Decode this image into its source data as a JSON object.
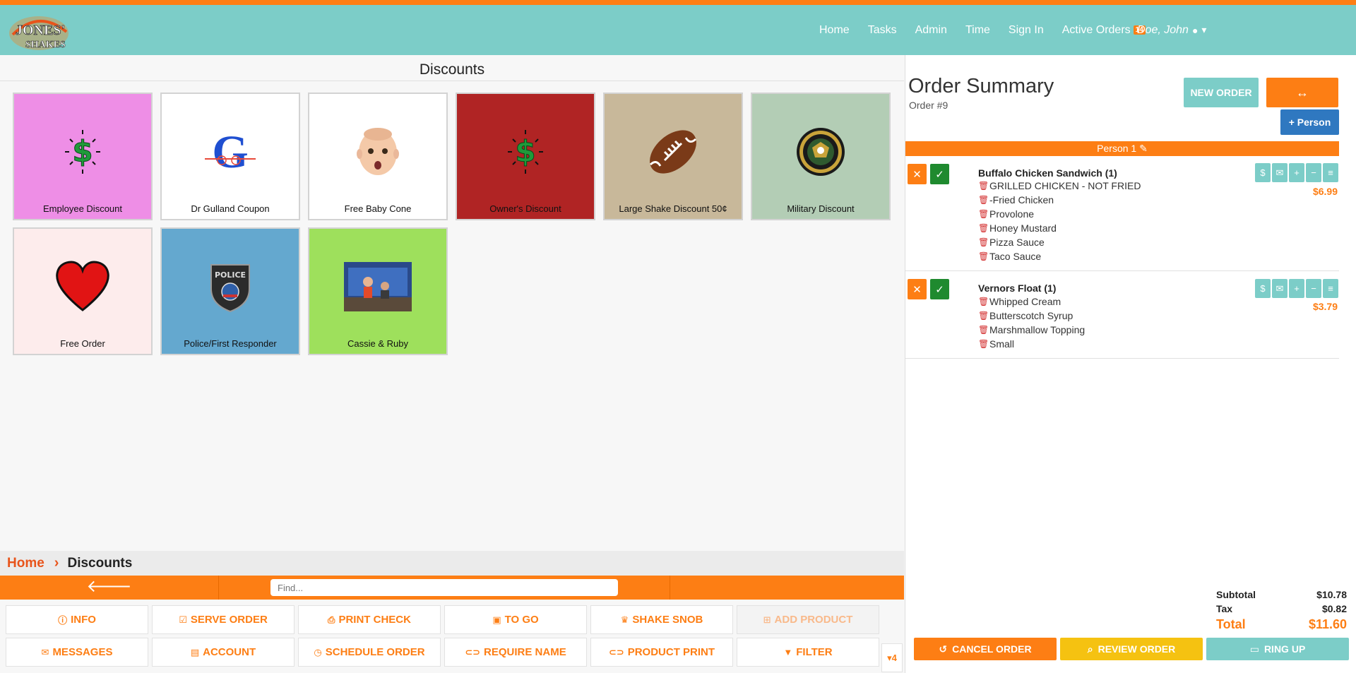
{
  "app": {
    "logo_text": "JONES' SHAKES",
    "nav": [
      {
        "label": "Home"
      },
      {
        "label": "Tasks"
      },
      {
        "label": "Admin"
      },
      {
        "label": "Time"
      },
      {
        "label": "Sign In"
      },
      {
        "label": "Active Orders",
        "badge": "14"
      }
    ],
    "user": "Doe, John"
  },
  "colors": {
    "accent": "#fd7e14",
    "teal": "#7ccdc8",
    "blue": "#2f78c0",
    "green": "#1f8a2f",
    "yellow": "#f5c211"
  },
  "discounts": {
    "title": "Discounts",
    "tiles": [
      {
        "label": "Employee Discount",
        "bg": "#ee8ee6",
        "icon": "dollar-icon"
      },
      {
        "label": "Dr Gulland Coupon",
        "bg": "#ffffff",
        "icon": "gulland-logo"
      },
      {
        "label": "Free Baby Cone",
        "bg": "#ffffff",
        "icon": "baby-face"
      },
      {
        "label": "Owner's Discount",
        "bg": "#b02424",
        "icon": "dollar-icon"
      },
      {
        "label": "Large Shake Discount 50¢",
        "bg": "#c8b89a",
        "icon": "football-icon"
      },
      {
        "label": "Military Discount",
        "bg": "#b3cdb5",
        "icon": "army-seal"
      },
      {
        "label": "Free Order",
        "bg": "#fdecec",
        "icon": "heart-icon"
      },
      {
        "label": "Police/First Responder",
        "bg": "#64a8cf",
        "icon": "police-badge"
      },
      {
        "label": "Cassie & Ruby",
        "bg": "#9ee05c",
        "icon": "photo"
      }
    ]
  },
  "breadcrumb": {
    "home": "Home",
    "current": "Discounts"
  },
  "search": {
    "placeholder": "Find..."
  },
  "actions": {
    "row1": [
      {
        "label": "INFO",
        "icon": "info-icon"
      },
      {
        "label": "SERVE ORDER",
        "icon": "check-square-icon"
      },
      {
        "label": "PRINT CHECK",
        "icon": "print-icon"
      },
      {
        "label": "TO GO",
        "icon": "bag-icon"
      },
      {
        "label": "SHAKE SNOB",
        "icon": "crown-icon"
      },
      {
        "label": "ADD PRODUCT",
        "icon": "plus-square-icon"
      }
    ],
    "row2": [
      {
        "label": "MESSAGES",
        "icon": "envelope-icon"
      },
      {
        "label": "ACCOUNT",
        "icon": "account-icon"
      },
      {
        "label": "SCHEDULE ORDER",
        "icon": "clock-icon"
      },
      {
        "label": "REQUIRE NAME",
        "icon": "toggle-icon"
      },
      {
        "label": "PRODUCT PRINT",
        "icon": "toggle-icon"
      },
      {
        "label": "FILTER",
        "icon": "filter-icon"
      }
    ],
    "more": "4"
  },
  "order": {
    "title": "Order Summary",
    "number": "Order #9",
    "new_order": "NEW ORDER",
    "swap": "↔",
    "add_person": "+ Person",
    "person": "Person 1",
    "items": [
      {
        "name": "Buffalo Chicken Sandwich (1)",
        "price": "$6.99",
        "mods": [
          "GRILLED CHICKEN - NOT FRIED",
          "-Fried Chicken",
          "Provolone",
          "Honey Mustard",
          "Pizza Sauce",
          "Taco Sauce"
        ]
      },
      {
        "name": "Vernors Float (1)",
        "price": "$3.79",
        "mods": [
          "Whipped Cream",
          "Butterscotch Syrup",
          "Marshmallow Topping",
          "Small"
        ]
      }
    ],
    "subtotal_label": "Subtotal",
    "subtotal": "$10.78",
    "tax_label": "Tax",
    "tax": "$0.82",
    "total_label": "Total",
    "total": "$11.60",
    "cancel": "CANCEL ORDER",
    "review": "REVIEW ORDER",
    "ring_up": "RING UP"
  }
}
